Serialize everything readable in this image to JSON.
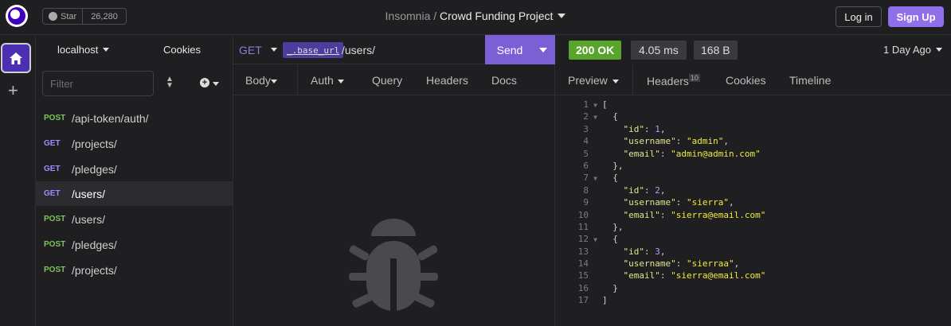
{
  "header": {
    "github": {
      "star_label": "Star",
      "star_count": "26,280"
    },
    "app_name": "Insomnia",
    "separator": "/",
    "project": "Crowd Funding Project",
    "login_label": "Log in",
    "signup_label": "Sign Up"
  },
  "sidebar": {
    "environment": "localhost",
    "cookies_label": "Cookies",
    "filter_placeholder": "Filter",
    "requests": [
      {
        "method": "POST",
        "path": "/api-token/auth/",
        "active": false
      },
      {
        "method": "GET",
        "path": "/projects/",
        "active": false
      },
      {
        "method": "GET",
        "path": "/pledges/",
        "active": false
      },
      {
        "method": "GET",
        "path": "/users/",
        "active": true
      },
      {
        "method": "POST",
        "path": "/users/",
        "active": false
      },
      {
        "method": "POST",
        "path": "/pledges/",
        "active": false
      },
      {
        "method": "POST",
        "path": "/projects/",
        "active": false
      }
    ]
  },
  "request": {
    "method": "GET",
    "url_variable": "_.base_url",
    "url_path": "/users/",
    "send_label": "Send",
    "tabs": {
      "body": "Body",
      "auth": "Auth",
      "query": "Query",
      "headers": "Headers",
      "docs": "Docs"
    }
  },
  "response": {
    "status": "200 OK",
    "time": "4.05 ms",
    "size": "168 B",
    "age": "1 Day Ago",
    "tabs": {
      "preview": "Preview",
      "headers": "Headers",
      "headers_count": "10",
      "cookies": "Cookies",
      "timeline": "Timeline"
    },
    "users": [
      {
        "id": 1,
        "username": "admin",
        "email": "admin@admin.com"
      },
      {
        "id": 2,
        "username": "sierra",
        "email": "sierra@email.com"
      },
      {
        "id": 3,
        "username": "sierraa",
        "email": "sierra@email.com"
      }
    ]
  },
  "colors": {
    "accent": "#7b5fd4",
    "status_ok": "#59a52c",
    "post_method": "#7dc45a",
    "get_method": "#9f8cff"
  }
}
